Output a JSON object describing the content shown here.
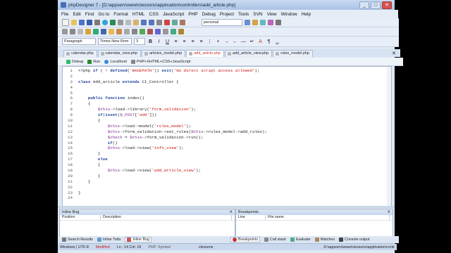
{
  "window": {
    "title": "phpDesigner 7 - [D:\\appserv\\www\\clessons\\application\\controllers\\add_article.php]",
    "controls": [
      "_",
      "□",
      "✕"
    ]
  },
  "menu": [
    "File",
    "Edit",
    "Find",
    "Go to",
    "Format",
    "HTML",
    "CSS",
    "JavaScript",
    "PHP",
    "Debug",
    "Project",
    "Tools",
    "SVN",
    "View",
    "Window",
    "Help"
  ],
  "toolbar": {
    "project_combo": "personal"
  },
  "format_bar": {
    "paragraph": "Paragraph",
    "font": "Times New Rom",
    "size": "3"
  },
  "tabs": [
    {
      "label": "calendar.php",
      "active": false
    },
    {
      "label": "calendar_view.php",
      "active": false
    },
    {
      "label": "articles_model.php",
      "active": false
    },
    {
      "label": "add_article.php",
      "active": true
    },
    {
      "label": "add_article_view.php",
      "active": false
    },
    {
      "label": "rules_model.php",
      "active": false
    }
  ],
  "editor_toolbar": {
    "debug": "Debug",
    "run": "Run",
    "server": "Localhost",
    "mode": "PHP+XHTML+CSS+JavaScript"
  },
  "code_lines": [
    {
      "n": "1",
      "t": "<?php if ( ! defined('BASEPATH')) exit('No direct script access allowed');"
    },
    {
      "n": "2",
      "t": ""
    },
    {
      "n": "3",
      "t": "class Add_article extends CI_Controller {"
    },
    {
      "n": "4",
      "t": ""
    },
    {
      "n": "5",
      "t": ""
    },
    {
      "n": "6",
      "t": "    public function index()"
    },
    {
      "n": "7",
      "t": "    {"
    },
    {
      "n": "8",
      "t": "        $this->load->library('form_validation');"
    },
    {
      "n": "9",
      "t": "        if(isset($_POST['add']))"
    },
    {
      "n": "10",
      "t": "        {"
    },
    {
      "n": "11",
      "t": "            $this->load->model('rules_model');"
    },
    {
      "n": "12",
      "t": "            $this->form_validation->set_rules($this->rules_model->add_rules);"
    },
    {
      "n": "13",
      "t": "            $check = $this->form_validation->run();"
    },
    {
      "n": "14",
      "t": "            if()"
    },
    {
      "n": "15",
      "t": "            $this->load->view('info_view');"
    },
    {
      "n": "16",
      "t": "        }"
    },
    {
      "n": "17",
      "t": "        else"
    },
    {
      "n": "18",
      "t": "        {"
    },
    {
      "n": "19",
      "t": "            $this->load->view('add_article_view');"
    },
    {
      "n": "20",
      "t": "        }"
    },
    {
      "n": "21",
      "t": "    }"
    },
    {
      "n": "22",
      "t": ""
    },
    {
      "n": "23",
      "t": "}"
    },
    {
      "n": "24",
      "t": ""
    }
  ],
  "inline_bug": {
    "title": "Inline Bug",
    "columns": [
      "Position",
      "Description"
    ]
  },
  "breakpoints": {
    "title": "Breakpoints",
    "columns": [
      "Line",
      "File name"
    ]
  },
  "bottom_tabs": [
    {
      "label": "Search Results",
      "active": false
    },
    {
      "label": "Inline Todo",
      "active": false
    },
    {
      "label": "Inline Bug",
      "active": true
    },
    {
      "label": "Breakpoints",
      "active": true
    },
    {
      "label": "Call stack",
      "active": false
    },
    {
      "label": "Evaluate",
      "active": false
    },
    {
      "label": "Watches",
      "active": false
    },
    {
      "label": "Console output",
      "active": false
    }
  ],
  "status": {
    "encoding": "Windows | UTF-8",
    "modified": "Modified",
    "position": "Ln : 14 Col: 16",
    "symbol": "PHP: Symbol",
    "project": "clessons",
    "path": "D:\\appserv\\www\\clessons\\application\\contr"
  },
  "colors": {
    "keyword": "#1a3f9c",
    "variable": "#7a2e8e",
    "string": "#c81010",
    "arrow": "#1a6a1a"
  }
}
